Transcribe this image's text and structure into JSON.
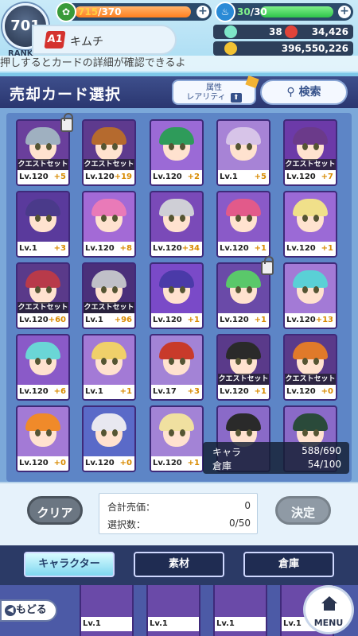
{
  "status": {
    "rank": "701",
    "rank_label": "RANK",
    "stamina_current": "715",
    "stamina_max": "/370",
    "stamina_fraction": 1.0,
    "energy_current": "30",
    "energy_max": "/30",
    "energy_fraction": 1.0,
    "player_grade": "A1",
    "player_name": "キムチ",
    "gems_small": "38",
    "gems_red": "34,426",
    "coins": "396,550,226",
    "ticker": "押しするとカードの詳細が確認できるよ"
  },
  "header": {
    "title": "売却カード選択",
    "sort_label_top": "属性",
    "sort_label_bottom": "レアリティ",
    "search_label": "検索"
  },
  "cards": [
    {
      "quest": "クエストセット中",
      "lv": "Lv.120",
      "plus": "+5",
      "lock": true,
      "hair": "#9fb0c0",
      "bg": "#6a3f9c"
    },
    {
      "quest": "クエストセット中",
      "lv": "Lv.120",
      "plus": "+19",
      "lock": false,
      "hair": "#b56a2e",
      "bg": "#5e3a8e"
    },
    {
      "quest": "",
      "lv": "Lv.120",
      "plus": "+2",
      "lock": false,
      "hair": "#2e9b5a",
      "bg": "#9b6ad6"
    },
    {
      "quest": "",
      "lv": "Lv.1",
      "plus": "+5",
      "lock": false,
      "hair": "#d7c4e8",
      "bg": "#a783d6"
    },
    {
      "quest": "クエストセット中",
      "lv": "Lv.120",
      "plus": "+7",
      "lock": false,
      "hair": "#6b3a8a",
      "bg": "#6c3aa8"
    },
    {
      "quest": "",
      "lv": "Lv.1",
      "plus": "+3",
      "lock": false,
      "hair": "#4a3a8a",
      "bg": "#5a3a9c"
    },
    {
      "quest": "",
      "lv": "Lv.120",
      "plus": "+8",
      "lock": false,
      "hair": "#e97ab8",
      "bg": "#a36ad6"
    },
    {
      "quest": "",
      "lv": "Lv.120",
      "plus": "+34",
      "lock": false,
      "hair": "#cfcfd6",
      "bg": "#7a4ab8"
    },
    {
      "quest": "",
      "lv": "Lv.120",
      "plus": "+1",
      "lock": false,
      "hair": "#e25a8a",
      "bg": "#8a5ac8"
    },
    {
      "quest": "",
      "lv": "Lv.120",
      "plus": "+1",
      "lock": false,
      "hair": "#f0e08a",
      "bg": "#9b6ad6"
    },
    {
      "quest": "クエストセット中",
      "lv": "Lv.120",
      "plus": "+60",
      "lock": false,
      "hair": "#b83a4a",
      "bg": "#5a3a8a"
    },
    {
      "quest": "クエストセット中",
      "lv": "Lv.1",
      "plus": "+96",
      "lock": false,
      "hair": "#c0c0c8",
      "bg": "#4a2f7a"
    },
    {
      "quest": "",
      "lv": "Lv.120",
      "plus": "+1",
      "lock": false,
      "hair": "#4a3aa8",
      "bg": "#7a4ac8"
    },
    {
      "quest": "",
      "lv": "Lv.120",
      "plus": "+1",
      "lock": true,
      "hair": "#5ac86a",
      "bg": "#6a4aa8"
    },
    {
      "quest": "",
      "lv": "Lv.120",
      "plus": "+13",
      "lock": false,
      "hair": "#5ad0d6",
      "bg": "#a37ad6"
    },
    {
      "quest": "",
      "lv": "Lv.120",
      "plus": "+6",
      "lock": false,
      "hair": "#6ad6d6",
      "bg": "#8a5ac8"
    },
    {
      "quest": "",
      "lv": "Lv.1",
      "plus": "+1",
      "lock": false,
      "hair": "#f0d06a",
      "bg": "#a37ad6"
    },
    {
      "quest": "",
      "lv": "Lv.17",
      "plus": "+3",
      "lock": false,
      "hair": "#c83a2a",
      "bg": "#a383d6"
    },
    {
      "quest": "クエストセット中",
      "lv": "Lv.120",
      "plus": "+1",
      "lock": false,
      "hair": "#2a2a2a",
      "bg": "#5a3a8a"
    },
    {
      "quest": "クエストセット中",
      "lv": "Lv.120",
      "plus": "+0",
      "lock": false,
      "hair": "#e07a2a",
      "bg": "#5a3a8a"
    },
    {
      "quest": "",
      "lv": "Lv.120",
      "plus": "+0",
      "lock": false,
      "hair": "#f08a2a",
      "bg": "#a37ad6"
    },
    {
      "quest": "",
      "lv": "Lv.120",
      "plus": "+0",
      "lock": false,
      "hair": "#e8e8f0",
      "bg": "#5a6ac8"
    },
    {
      "quest": "",
      "lv": "Lv.120",
      "plus": "+1",
      "lock": false,
      "hair": "#f0e0a0",
      "bg": "#a383d6"
    },
    {
      "quest": "",
      "lv": "",
      "plus": "",
      "lock": false,
      "hair": "#2a2a2a",
      "bg": "#8a6ac8"
    },
    {
      "quest": "",
      "lv": "",
      "plus": "",
      "lock": false,
      "hair": "#2a4a3a",
      "bg": "#8a6ac8"
    }
  ],
  "counts": {
    "chara_label": "キャラ",
    "chara_value": "588/690",
    "storage_label": "倉庫",
    "storage_value": "54/100"
  },
  "summary": {
    "clear_label": "クリア",
    "total_label": "合計売価：",
    "total_value": "0",
    "selected_label": "選択数：",
    "selected_value": "0/50",
    "decide_label": "決定"
  },
  "tabs": [
    "キャラクター",
    "素材",
    "倉庫"
  ],
  "nav": {
    "back_label": "もどる",
    "menu_label": "MENU",
    "lower_levels": [
      "Lv.1",
      "Lv.1",
      "Lv.1",
      "Lv.1"
    ]
  },
  "colors": {
    "stamina": "#ff7f1f",
    "energy": "#2ec44a",
    "plus": "#d88a00",
    "grade_badge": "#d4322e"
  }
}
